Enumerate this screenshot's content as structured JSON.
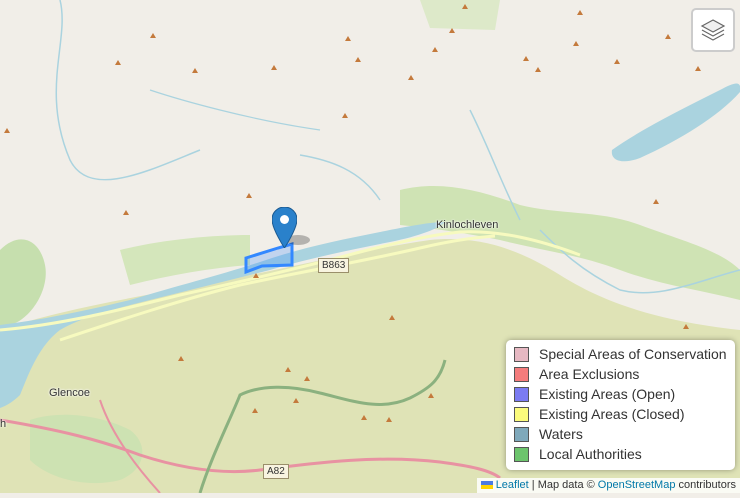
{
  "map": {
    "places": {
      "kinlochleven": "Kinlochleven",
      "glencoe": "Glencoe",
      "edge_fragment": "h"
    },
    "roads": {
      "b863": "B863",
      "a82": "A82"
    }
  },
  "controls": {
    "layers_icon": "layers-icon"
  },
  "legend": {
    "items": [
      {
        "label": "Special Areas of Conservation",
        "color": "#e6b8c2"
      },
      {
        "label": "Area Exclusions",
        "color": "#f47c7c"
      },
      {
        "label": "Existing Areas (Open)",
        "color": "#7b7bf2"
      },
      {
        "label": "Existing Areas (Closed)",
        "color": "#fbfb7c"
      },
      {
        "label": "Waters",
        "color": "#7fa9bb"
      },
      {
        "label": "Local Authorities",
        "color": "#6cc46c"
      }
    ]
  },
  "attribution": {
    "leaflet": "Leaflet",
    "separator": "| Map data ©",
    "osm": "OpenStreetMap",
    "contributors": "contributors"
  },
  "colors": {
    "land": "#f1eee8",
    "water": "#aad3df",
    "park": "#dfe4b8",
    "green": "#c8dfb4",
    "polygon": "#3388ff",
    "marker": "#2a81cb"
  }
}
